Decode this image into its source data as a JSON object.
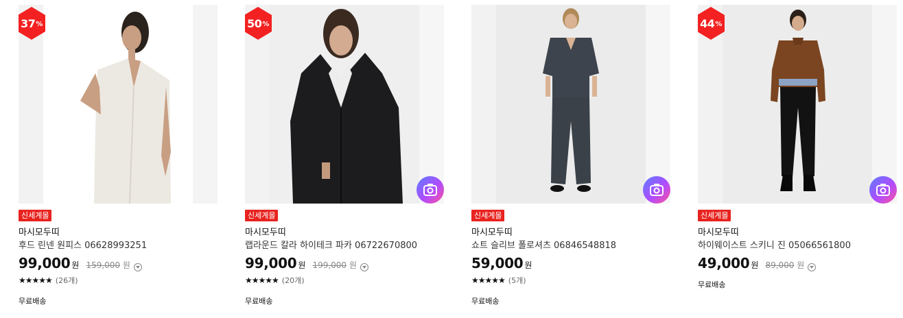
{
  "products": [
    {
      "discount": "37",
      "discount_unit": "%",
      "tag": "신세계몰",
      "brand": "마시모두띠",
      "name": "후드 린넨 원피스 06628993251",
      "price": "99,000",
      "currency": "원",
      "original_price": "159,000",
      "stars": "★★★★★",
      "reviews": "(26개)",
      "shipping": "무료배송",
      "image_icon": "model-white-dress-photo",
      "has_camera_button": false
    },
    {
      "discount": "50",
      "discount_unit": "%",
      "tag": "신세계몰",
      "brand": "마시모두띠",
      "name": "랩라운드 칼라 하이테크 파카 06722670800",
      "price": "99,000",
      "currency": "원",
      "original_price": "199,000",
      "stars": "★★★★★",
      "reviews": "(20개)",
      "shipping": "무료배송",
      "image_icon": "model-black-parka-photo",
      "has_camera_button": true
    },
    {
      "tag": "신세계몰",
      "brand": "마시모두띠",
      "name": "쇼트 슬리브 폴로셔츠 06846548818",
      "price": "59,000",
      "currency": "원",
      "stars": "★★★★★",
      "reviews": "(5개)",
      "shipping": "무료배송",
      "image_icon": "model-grey-polo-set-photo",
      "has_camera_button": true
    },
    {
      "discount": "44",
      "discount_unit": "%",
      "tag": "신세계몰",
      "brand": "마시모두띠",
      "name": "하이웨이스트 스키니 진 05066561800",
      "price": "49,000",
      "currency": "원",
      "original_price": "89,000",
      "shipping": "무료배송",
      "image_icon": "model-brown-sweater-photo",
      "has_camera_button": true
    }
  ],
  "colors": {
    "discount_badge": "#f32121",
    "store_tag": "#e8231f",
    "camera_gradient_start": "#5b7cff",
    "camera_gradient_end": "#ff4f9a"
  },
  "icons": {
    "camera": "camera-icon",
    "info": "info-icon",
    "star": "star-icon"
  }
}
